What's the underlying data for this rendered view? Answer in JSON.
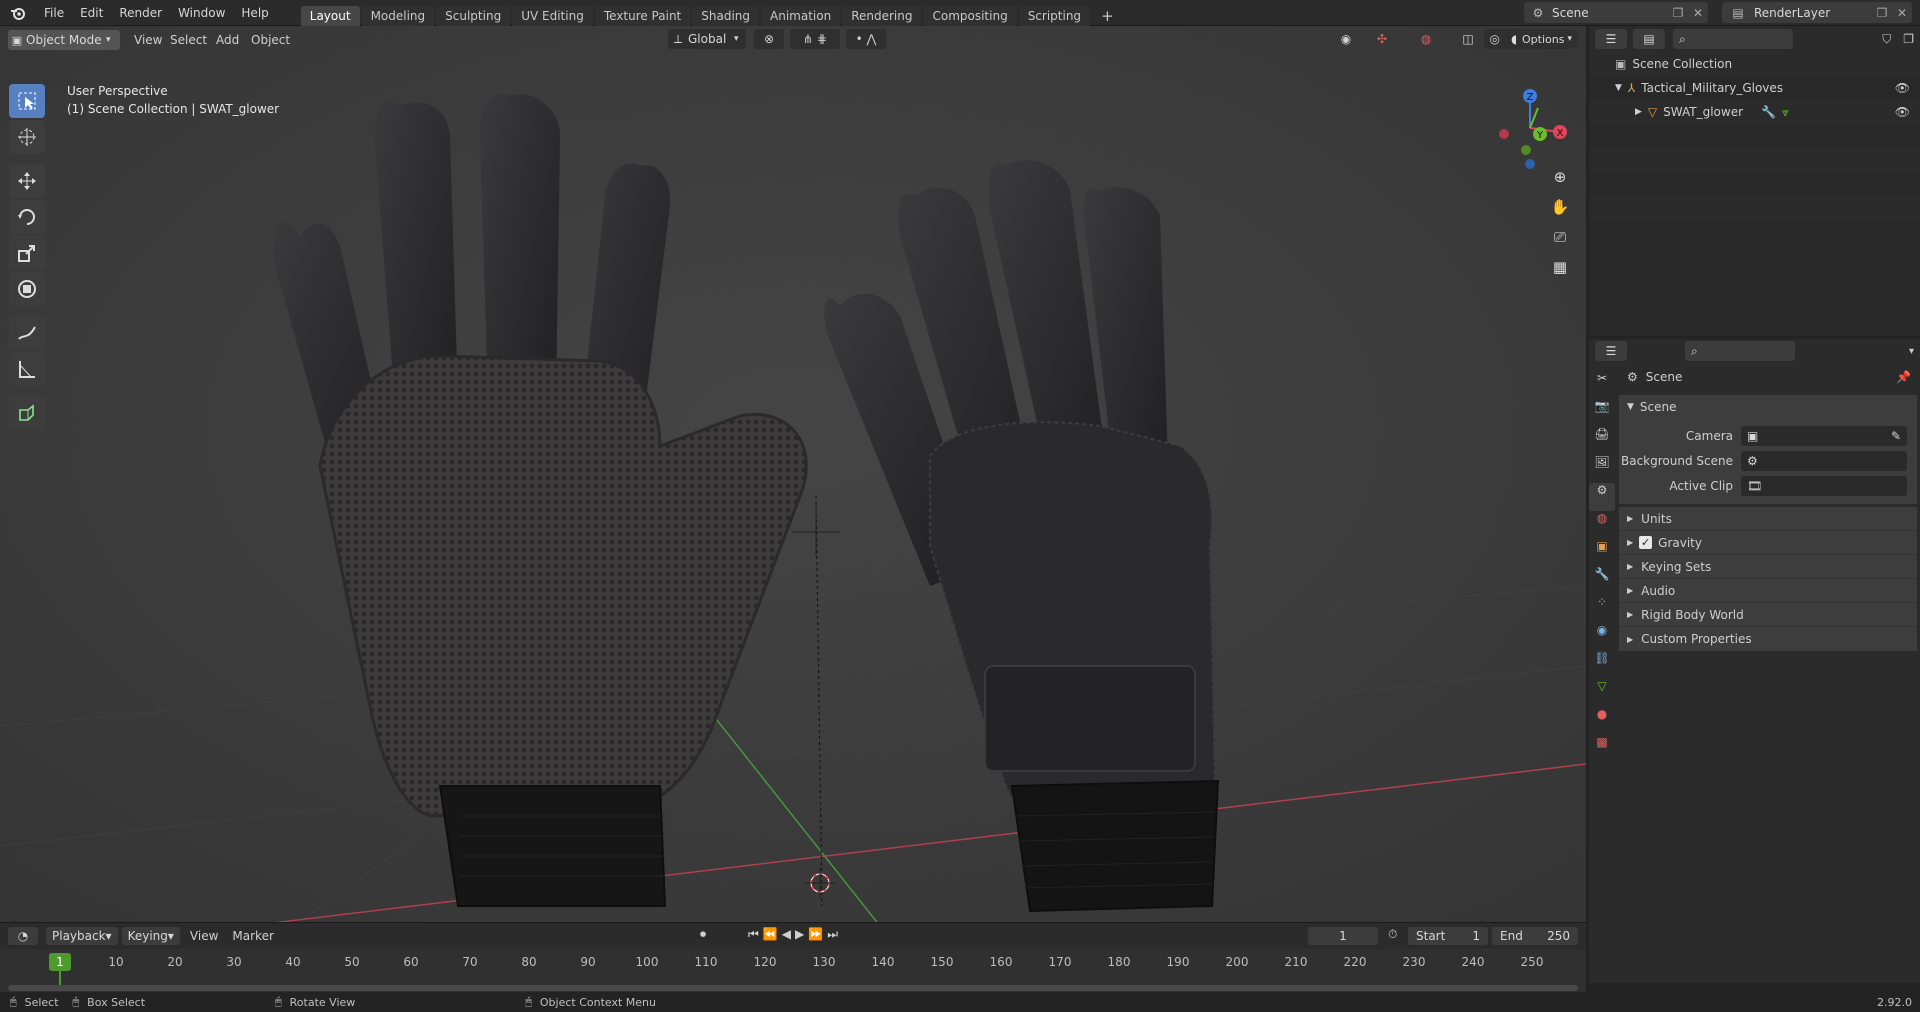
{
  "menu": [
    "File",
    "Edit",
    "Render",
    "Window",
    "Help"
  ],
  "workspaces": [
    "Layout",
    "Modeling",
    "Sculpting",
    "UV Editing",
    "Texture Paint",
    "Shading",
    "Animation",
    "Rendering",
    "Compositing",
    "Scripting"
  ],
  "active_workspace": "Layout",
  "scene_name": "Scene",
  "render_layer": "RenderLayer",
  "viewport": {
    "mode": "Object Mode",
    "menus": [
      "View",
      "Select",
      "Add",
      "Object"
    ],
    "transform_orientation": "Global",
    "options_label": "Options",
    "overlay_title": "User Perspective",
    "overlay_subtitle": "(1) Scene Collection | SWAT_glower",
    "gizmo_axes": [
      "X",
      "Y",
      "Z"
    ]
  },
  "outliner": {
    "root": "Scene Collection",
    "collection": "Tactical_Military_Gloves",
    "object": "SWAT_glower"
  },
  "properties": {
    "context": "Scene",
    "section": "Scene",
    "fields": [
      {
        "label": "Camera",
        "value": ""
      },
      {
        "label": "Background Scene",
        "value": ""
      },
      {
        "label": "Active Clip",
        "value": ""
      }
    ],
    "subpanels": [
      "Units",
      "Gravity",
      "Keying Sets",
      "Audio",
      "Rigid Body World",
      "Custom Properties"
    ],
    "gravity_checked": true
  },
  "timeline": {
    "menus": [
      "Playback",
      "Keying",
      "View",
      "Marker"
    ],
    "current_frame": "1",
    "start_label": "Start",
    "start": "1",
    "end_label": "End",
    "end": "250",
    "ticks": [
      "10",
      "20",
      "30",
      "40",
      "50",
      "60",
      "70",
      "80",
      "90",
      "100",
      "110",
      "120",
      "130",
      "140",
      "150",
      "160",
      "170",
      "180",
      "190",
      "200",
      "210",
      "220",
      "230",
      "240",
      "250"
    ],
    "current_tick": "1"
  },
  "status": {
    "select": "Select",
    "box_select": "Box Select",
    "rotate_view": "Rotate View",
    "context_menu": "Object Context Menu",
    "version": "2.92.0"
  },
  "colors": {
    "accent": "#5680c2",
    "axis_x": "#e0455c",
    "axis_y": "#6dbb2e",
    "axis_z": "#3d7fe0"
  }
}
